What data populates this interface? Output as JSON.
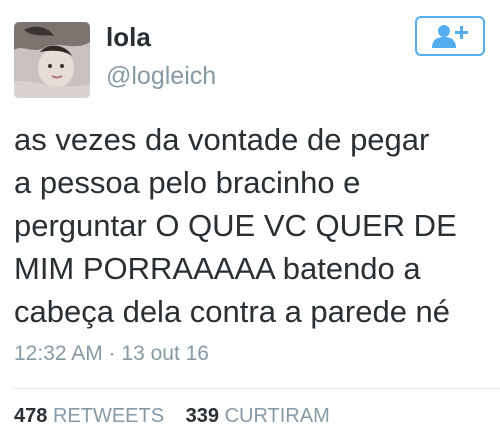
{
  "user": {
    "display_name": "lola",
    "handle": "@logleich"
  },
  "follow_button": {
    "icon": "add-user-icon",
    "accent_color": "#55acee"
  },
  "tweet": {
    "lines": [
      "as vezes da vontade de pegar",
      "a pessoa pelo bracinho e",
      "perguntar O QUE VC QUER DE",
      "MIM PORRAAAAA batendo a",
      "cabeça dela contra a parede né"
    ],
    "timestamp": "12:32 AM · 13 out 16"
  },
  "stats": {
    "retweets_count": "478",
    "retweets_label": "RETWEETS",
    "likes_count": "339",
    "likes_label": "CURTIRAM"
  }
}
